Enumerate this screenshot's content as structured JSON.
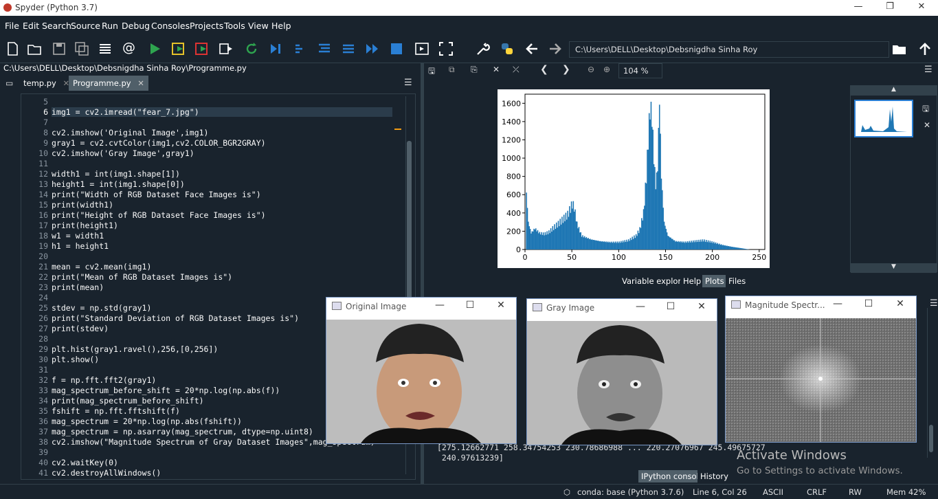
{
  "window": {
    "title": "Spyder (Python 3.7)",
    "min": "—",
    "max": "❐",
    "close": "✕"
  },
  "menu": [
    "File",
    "Edit",
    "Search",
    "Source",
    "Run",
    "Debug",
    "Consoles",
    "Projects",
    "Tools",
    "View",
    "Help"
  ],
  "toolbar": {
    "path": "C:\\Users\\DELL\\Desktop\\Debsnigdha Sinha Roy"
  },
  "editor": {
    "file_path": "C:\\Users\\DELL\\Desktop\\Debsnigdha Sinha Roy\\Programme.py",
    "tabs": [
      "temp.py",
      "Programme.py"
    ],
    "lines": [
      {
        "n": "5",
        "t": ""
      },
      {
        "n": "6",
        "t": "img1 = cv2.imread(\"fear_7.jpg\")"
      },
      {
        "n": "7",
        "t": ""
      },
      {
        "n": "8",
        "t": "cv2.imshow('Original Image',img1)"
      },
      {
        "n": "9",
        "t": "gray1 = cv2.cvtColor(img1,cv2.COLOR_BGR2GRAY)"
      },
      {
        "n": "10",
        "t": "cv2.imshow('Gray Image',gray1)"
      },
      {
        "n": "11",
        "t": ""
      },
      {
        "n": "12",
        "t": "width1 = int(img1.shape[1])"
      },
      {
        "n": "13",
        "t": "height1 = int(img1.shape[0])"
      },
      {
        "n": "14",
        "t": "print(\"Width of RGB Dataset Face Images is\")"
      },
      {
        "n": "15",
        "t": "print(width1)"
      },
      {
        "n": "16",
        "t": "print(\"Height of RGB Dataset Face Images is\")"
      },
      {
        "n": "17",
        "t": "print(height1)"
      },
      {
        "n": "18",
        "t": "w1 = width1"
      },
      {
        "n": "19",
        "t": "h1 = height1"
      },
      {
        "n": "20",
        "t": ""
      },
      {
        "n": "21",
        "t": "mean = cv2.mean(img1)"
      },
      {
        "n": "22",
        "t": "print(\"Mean of RGB Dataset Images is\")"
      },
      {
        "n": "23",
        "t": "print(mean)"
      },
      {
        "n": "24",
        "t": ""
      },
      {
        "n": "25",
        "t": "stdev = np.std(gray1)"
      },
      {
        "n": "26",
        "t": "print(\"Standard Deviation of RGB Dataset Images is\")"
      },
      {
        "n": "27",
        "t": "print(stdev)"
      },
      {
        "n": "28",
        "t": ""
      },
      {
        "n": "29",
        "t": "plt.hist(gray1.ravel(),256,[0,256])"
      },
      {
        "n": "30",
        "t": "plt.show()"
      },
      {
        "n": "31",
        "t": ""
      },
      {
        "n": "32",
        "t": "f = np.fft.fft2(gray1)"
      },
      {
        "n": "33",
        "t": "mag_spectrum_before_shift = 20*np.log(np.abs(f))"
      },
      {
        "n": "34",
        "t": "print(mag_spectrum_before_shift)"
      },
      {
        "n": "35",
        "t": "fshift = np.fft.fftshift(f)"
      },
      {
        "n": "36",
        "t": "mag_spectrum = 20*np.log(np.abs(fshift))"
      },
      {
        "n": "37",
        "t": "mag_spectrum = np.asarray(mag_spectrum, dtype=np.uint8)"
      },
      {
        "n": "38",
        "t": "cv2.imshow(\"Magnitude Spectrum of Gray Dataset Images\",mag_spectrum)"
      },
      {
        "n": "39",
        "t": ""
      },
      {
        "n": "40",
        "t": "cv2.waitKey(0)"
      },
      {
        "n": "41",
        "t": "cv2.destroyAllWindows()"
      }
    ]
  },
  "plots": {
    "zoom": "104 %",
    "tabs": [
      "Variable explorer",
      "Help",
      "Plots",
      "Files"
    ]
  },
  "chart_data": {
    "type": "bar",
    "xticks": [
      "0",
      "50",
      "100",
      "150",
      "200",
      "250"
    ],
    "yticks": [
      "0",
      "200",
      "400",
      "600",
      "800",
      "1000",
      "1200",
      "1400",
      "1600"
    ],
    "xlim": [
      0,
      256
    ],
    "ylim": [
      0,
      1700
    ],
    "color": "#1f77b4",
    "values_coarse": [
      {
        "x": 1,
        "y": 620
      },
      {
        "x": 3,
        "y": 300
      },
      {
        "x": 6,
        "y": 180
      },
      {
        "x": 10,
        "y": 230
      },
      {
        "x": 15,
        "y": 180
      },
      {
        "x": 20,
        "y": 170
      },
      {
        "x": 25,
        "y": 190
      },
      {
        "x": 30,
        "y": 240
      },
      {
        "x": 35,
        "y": 280
      },
      {
        "x": 40,
        "y": 330
      },
      {
        "x": 45,
        "y": 380
      },
      {
        "x": 48,
        "y": 450
      },
      {
        "x": 50,
        "y": 500
      },
      {
        "x": 52,
        "y": 460
      },
      {
        "x": 55,
        "y": 280
      },
      {
        "x": 60,
        "y": 150
      },
      {
        "x": 70,
        "y": 110
      },
      {
        "x": 80,
        "y": 90
      },
      {
        "x": 90,
        "y": 80
      },
      {
        "x": 100,
        "y": 80
      },
      {
        "x": 110,
        "y": 100
      },
      {
        "x": 118,
        "y": 150
      },
      {
        "x": 122,
        "y": 220
      },
      {
        "x": 126,
        "y": 400
      },
      {
        "x": 129,
        "y": 800
      },
      {
        "x": 131,
        "y": 1200
      },
      {
        "x": 133,
        "y": 1550
      },
      {
        "x": 135,
        "y": 1450
      },
      {
        "x": 137,
        "y": 1000
      },
      {
        "x": 139,
        "y": 700
      },
      {
        "x": 141,
        "y": 900
      },
      {
        "x": 143,
        "y": 1650
      },
      {
        "x": 145,
        "y": 800
      },
      {
        "x": 148,
        "y": 300
      },
      {
        "x": 152,
        "y": 150
      },
      {
        "x": 160,
        "y": 90
      },
      {
        "x": 170,
        "y": 80
      },
      {
        "x": 180,
        "y": 90
      },
      {
        "x": 190,
        "y": 100
      },
      {
        "x": 200,
        "y": 80
      },
      {
        "x": 210,
        "y": 50
      },
      {
        "x": 220,
        "y": 30
      },
      {
        "x": 230,
        "y": 15
      },
      {
        "x": 236,
        "y": 5
      },
      {
        "x": 240,
        "y": 0
      }
    ]
  },
  "console": {
    "output1": "[275.12662771 258.34754253 230.78686988 ... 220.27076967 245.49675727",
    "output2": " 240.97613239]",
    "tabs": [
      "IPython console",
      "History"
    ]
  },
  "cv_windows": [
    {
      "title": "Original Image"
    },
    {
      "title": "Gray Image"
    },
    {
      "title": "Magnitude Spectr..."
    }
  ],
  "watermark": {
    "line1": "Activate Windows",
    "line2": "Go to Settings to activate Windows."
  },
  "status": {
    "env": "conda: base (Python 3.7.6)",
    "pos": "Line 6, Col 26",
    "enc": "ASCII",
    "eol": "CRLF",
    "rw": "RW",
    "mem": "Mem 42%"
  }
}
